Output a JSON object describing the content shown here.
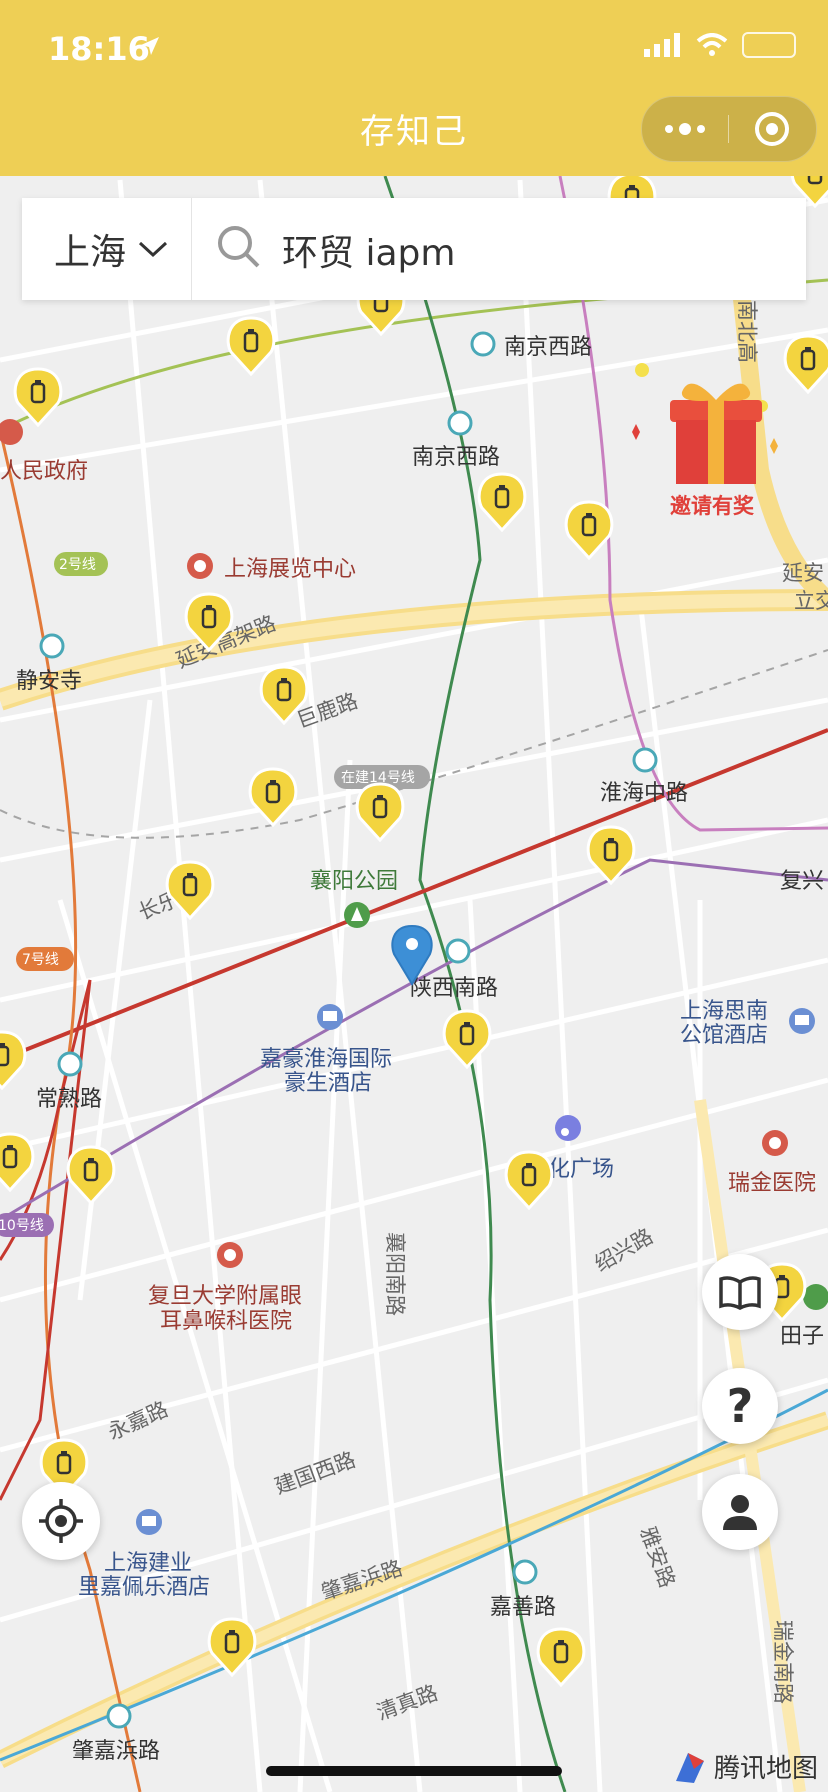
{
  "status_bar": {
    "time": "18:16"
  },
  "header": {
    "title": "存知己"
  },
  "search": {
    "city": "上海",
    "query": "环贸 iapm"
  },
  "promo": {
    "label": "邀请有奖"
  },
  "map": {
    "places": [
      {
        "name": "南京西路",
        "kind": "metro"
      },
      {
        "name": "南京西路",
        "kind": "metro"
      },
      {
        "name": "静安寺",
        "kind": "metro"
      },
      {
        "name": "淮海中路",
        "kind": "metro"
      },
      {
        "name": "陕西南路",
        "kind": "metro"
      },
      {
        "name": "常熟路",
        "kind": "metro"
      },
      {
        "name": "嘉善路",
        "kind": "metro"
      },
      {
        "name": "肇嘉浜路",
        "kind": "metro"
      },
      {
        "name": "人民政府",
        "kind": "poi"
      },
      {
        "name": "上海展览中心",
        "kind": "poi"
      },
      {
        "name": "襄阳公园",
        "kind": "park"
      },
      {
        "name": "嘉豪淮海国际豪生酒店",
        "kind": "hotel"
      },
      {
        "name": "上海思南公馆酒店",
        "kind": "hotel"
      },
      {
        "name": "瑞金医院",
        "kind": "hospital"
      },
      {
        "name": "复旦大学附属眼耳鼻喉科医院",
        "kind": "hospital"
      },
      {
        "name": "化广场",
        "kind": "poi"
      },
      {
        "name": "上海建业里嘉佩乐酒店",
        "kind": "hotel"
      },
      {
        "name": "复兴",
        "kind": "metro"
      },
      {
        "name": "田子",
        "kind": "poi"
      }
    ],
    "roads": [
      "延安高架路",
      "巨鹿路",
      "长乐",
      "襄阳南路",
      "绍兴路",
      "永嘉路",
      "建国西路",
      "肇嘉浜路",
      "清真路",
      "雅安路",
      "瑞金南路",
      "南北高架",
      "延安立交"
    ],
    "line_tags": [
      "2号线",
      "7号线",
      "10号线",
      "在建14号线"
    ],
    "map_logo": "腾讯地图"
  },
  "controls": [
    "guide",
    "help",
    "user",
    "locate"
  ],
  "colors": {
    "brand": "#eecf55",
    "marker": "#f3d43f",
    "selected_pin": "#3d8fd6"
  }
}
